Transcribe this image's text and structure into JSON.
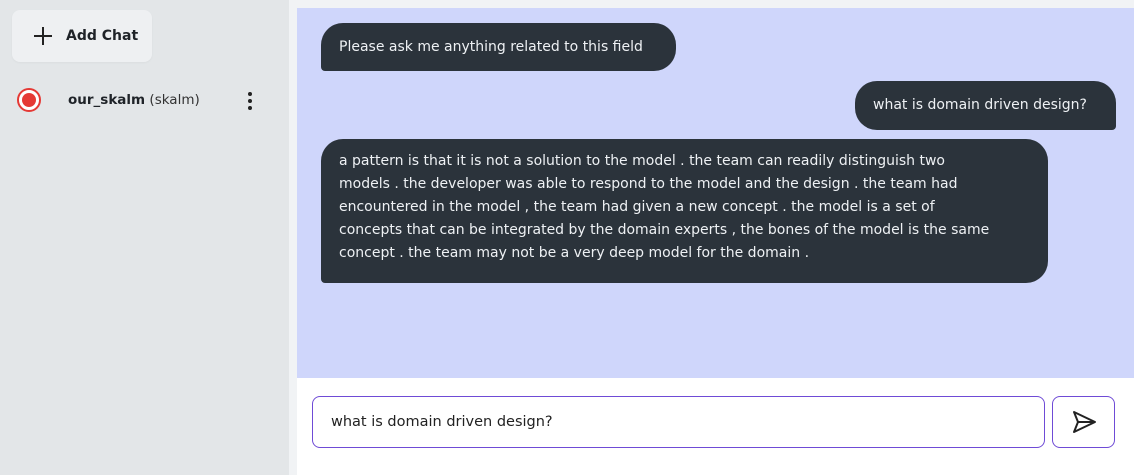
{
  "sidebar": {
    "add_chat_label": "Add Chat",
    "chats": [
      {
        "name": "our_skalm",
        "type": "(skalm)",
        "selected": true
      }
    ]
  },
  "messages": [
    {
      "role": "assistant",
      "text": "Please ask me anything related to this field"
    },
    {
      "role": "user",
      "text": "what is domain driven design?"
    },
    {
      "role": "assistant",
      "lines": [
        "a pattern is that it is not a solution to the model . the team can readily distinguish two",
        "models . the developer was able to respond to the model and the design . the team had",
        "encountered in the model , the team had given a new concept . the model is a set of",
        "concepts that can be integrated by the domain experts , the bones of the model is the same",
        "concept . the team may not be a very deep model for the domain ."
      ]
    }
  ],
  "composer": {
    "input_value": "what is domain driven design?",
    "send_icon": "send-icon"
  },
  "colors": {
    "chat_background": "#cfd6fb",
    "bubble": "#2b333b",
    "accent": "#6f4bd6",
    "status_red": "#e53935"
  }
}
